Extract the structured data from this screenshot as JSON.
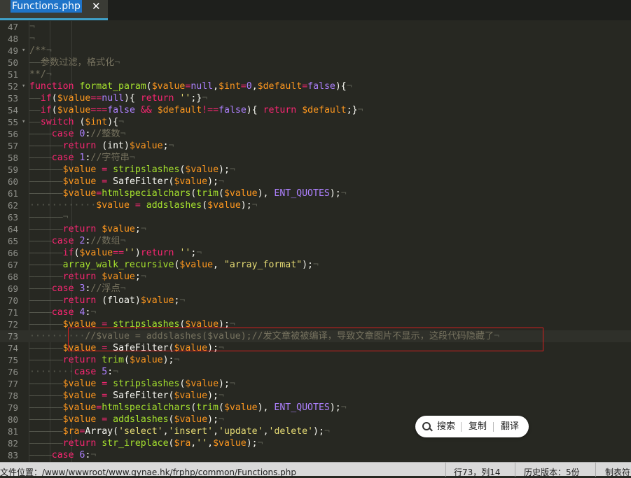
{
  "tab": {
    "title": "Functions.php",
    "close": "✕"
  },
  "lines": [
    {
      "n": "47",
      "fold": "",
      "segs": [
        [
          "w",
          "¬"
        ]
      ]
    },
    {
      "n": "48",
      "fold": "",
      "segs": [
        [
          "w",
          "¬"
        ]
      ]
    },
    {
      "n": "49",
      "fold": "▾",
      "segs": [
        [
          "c",
          "/**"
        ],
        [
          "w",
          "¬"
        ]
      ]
    },
    {
      "n": "50",
      "fold": "",
      "segs": [
        [
          "w",
          "——"
        ],
        [
          "c",
          "参数过滤，格式化"
        ],
        [
          "w",
          "¬"
        ]
      ]
    },
    {
      "n": "51",
      "fold": "",
      "segs": [
        [
          "c",
          "**/"
        ],
        [
          "w",
          "¬"
        ]
      ]
    },
    {
      "n": "52",
      "fold": "▾",
      "segs": [
        [
          "k",
          "function"
        ],
        [
          "t",
          " "
        ],
        [
          "f",
          "format_param"
        ],
        [
          "t",
          "("
        ],
        [
          "v",
          "$value"
        ],
        [
          "k",
          "="
        ],
        [
          "n",
          "null"
        ],
        [
          "t",
          ","
        ],
        [
          "v",
          "$int"
        ],
        [
          "k",
          "="
        ],
        [
          "n",
          "0"
        ],
        [
          "t",
          ","
        ],
        [
          "v",
          "$default"
        ],
        [
          "k",
          "="
        ],
        [
          "n",
          "false"
        ],
        [
          "t",
          "){"
        ],
        [
          "w",
          "¬"
        ]
      ]
    },
    {
      "n": "53",
      "fold": "",
      "segs": [
        [
          "w",
          "——"
        ],
        [
          "k",
          "if"
        ],
        [
          "t",
          "("
        ],
        [
          "v",
          "$value"
        ],
        [
          "k",
          "=="
        ],
        [
          "n",
          "null"
        ],
        [
          "t",
          "){ "
        ],
        [
          "k",
          "return"
        ],
        [
          "t",
          " "
        ],
        [
          "s1",
          "''"
        ],
        [
          "t",
          ";}"
        ],
        [
          "w",
          "¬"
        ]
      ]
    },
    {
      "n": "54",
      "fold": "",
      "segs": [
        [
          "w",
          "——"
        ],
        [
          "k",
          "if"
        ],
        [
          "t",
          "("
        ],
        [
          "v",
          "$value"
        ],
        [
          "k",
          "==="
        ],
        [
          "n",
          "false"
        ],
        [
          "t",
          " "
        ],
        [
          "k",
          "&&"
        ],
        [
          "t",
          " "
        ],
        [
          "v",
          "$default"
        ],
        [
          "k",
          "!=="
        ],
        [
          "n",
          "false"
        ],
        [
          "t",
          "){ "
        ],
        [
          "k",
          "return"
        ],
        [
          "t",
          " "
        ],
        [
          "v",
          "$default"
        ],
        [
          "t",
          ";}"
        ],
        [
          "w",
          "¬"
        ]
      ]
    },
    {
      "n": "55",
      "fold": "▾",
      "segs": [
        [
          "w",
          "——"
        ],
        [
          "k",
          "switch"
        ],
        [
          "t",
          " ("
        ],
        [
          "v",
          "$int"
        ],
        [
          "t",
          "){"
        ],
        [
          "w",
          "¬"
        ]
      ]
    },
    {
      "n": "56",
      "fold": "",
      "segs": [
        [
          "w",
          "————"
        ],
        [
          "k",
          "case"
        ],
        [
          "t",
          " "
        ],
        [
          "n",
          "0"
        ],
        [
          "t",
          ":"
        ],
        [
          "c",
          "//整数"
        ],
        [
          "w",
          "¬"
        ]
      ]
    },
    {
      "n": "57",
      "fold": "",
      "segs": [
        [
          "w",
          "——————"
        ],
        [
          "k",
          "return"
        ],
        [
          "t",
          " (int)"
        ],
        [
          "v",
          "$value"
        ],
        [
          "t",
          ";"
        ],
        [
          "w",
          "¬"
        ]
      ]
    },
    {
      "n": "58",
      "fold": "",
      "segs": [
        [
          "w",
          "————"
        ],
        [
          "k",
          "case"
        ],
        [
          "t",
          " "
        ],
        [
          "n",
          "1"
        ],
        [
          "t",
          ":"
        ],
        [
          "c",
          "//字符串"
        ],
        [
          "w",
          "¬"
        ]
      ]
    },
    {
      "n": "59",
      "fold": "",
      "segs": [
        [
          "w",
          "——————"
        ],
        [
          "v",
          "$value"
        ],
        [
          "t",
          " "
        ],
        [
          "k",
          "="
        ],
        [
          "t",
          " "
        ],
        [
          "f",
          "stripslashes"
        ],
        [
          "t",
          "("
        ],
        [
          "v",
          "$value"
        ],
        [
          "t",
          ");"
        ],
        [
          "w",
          "¬"
        ]
      ]
    },
    {
      "n": "60",
      "fold": "",
      "segs": [
        [
          "w",
          "——————"
        ],
        [
          "v",
          "$value"
        ],
        [
          "t",
          " "
        ],
        [
          "k",
          "="
        ],
        [
          "t",
          " SafeFilter("
        ],
        [
          "v",
          "$value"
        ],
        [
          "t",
          ");"
        ],
        [
          "w",
          "¬"
        ]
      ]
    },
    {
      "n": "61",
      "fold": "",
      "segs": [
        [
          "w",
          "——————"
        ],
        [
          "v",
          "$value"
        ],
        [
          "k",
          "="
        ],
        [
          "f",
          "htmlspecialchars"
        ],
        [
          "t",
          "("
        ],
        [
          "f",
          "trim"
        ],
        [
          "t",
          "("
        ],
        [
          "v",
          "$value"
        ],
        [
          "t",
          "), "
        ],
        [
          "n",
          "ENT_QUOTES"
        ],
        [
          "t",
          ");"
        ],
        [
          "w",
          "¬"
        ]
      ]
    },
    {
      "n": "62",
      "fold": "",
      "segs": [
        [
          "w",
          "············"
        ],
        [
          "v",
          "$value"
        ],
        [
          "t",
          " "
        ],
        [
          "k",
          "="
        ],
        [
          "t",
          " "
        ],
        [
          "f",
          "addslashes"
        ],
        [
          "t",
          "("
        ],
        [
          "v",
          "$value"
        ],
        [
          "t",
          ");"
        ],
        [
          "w",
          "¬"
        ]
      ]
    },
    {
      "n": "63",
      "fold": "",
      "segs": [
        [
          "w",
          "——————¬"
        ]
      ]
    },
    {
      "n": "64",
      "fold": "",
      "segs": [
        [
          "w",
          "——————"
        ],
        [
          "k",
          "return"
        ],
        [
          "t",
          " "
        ],
        [
          "v",
          "$value"
        ],
        [
          "t",
          ";"
        ],
        [
          "w",
          "¬"
        ]
      ]
    },
    {
      "n": "65",
      "fold": "",
      "segs": [
        [
          "w",
          "————"
        ],
        [
          "k",
          "case"
        ],
        [
          "t",
          " "
        ],
        [
          "n",
          "2"
        ],
        [
          "t",
          ":"
        ],
        [
          "c",
          "//数组"
        ],
        [
          "w",
          "¬"
        ]
      ]
    },
    {
      "n": "66",
      "fold": "",
      "segs": [
        [
          "w",
          "——————"
        ],
        [
          "k",
          "if"
        ],
        [
          "t",
          "("
        ],
        [
          "v",
          "$value"
        ],
        [
          "k",
          "=="
        ],
        [
          "s1",
          "''"
        ],
        [
          "t",
          ")"
        ],
        [
          "k",
          "return"
        ],
        [
          "t",
          " "
        ],
        [
          "s1",
          "''"
        ],
        [
          "t",
          ";"
        ],
        [
          "w",
          "¬"
        ]
      ]
    },
    {
      "n": "67",
      "fold": "",
      "segs": [
        [
          "w",
          "——————"
        ],
        [
          "f",
          "array_walk_recursive"
        ],
        [
          "t",
          "("
        ],
        [
          "v",
          "$value"
        ],
        [
          "t",
          ", "
        ],
        [
          "s1",
          "\"array_format\""
        ],
        [
          "t",
          ");"
        ],
        [
          "w",
          "¬"
        ]
      ]
    },
    {
      "n": "68",
      "fold": "",
      "segs": [
        [
          "w",
          "——————"
        ],
        [
          "k",
          "return"
        ],
        [
          "t",
          " "
        ],
        [
          "v",
          "$value"
        ],
        [
          "t",
          ";"
        ],
        [
          "w",
          "¬"
        ]
      ]
    },
    {
      "n": "69",
      "fold": "",
      "segs": [
        [
          "w",
          "————"
        ],
        [
          "k",
          "case"
        ],
        [
          "t",
          " "
        ],
        [
          "n",
          "3"
        ],
        [
          "t",
          ":"
        ],
        [
          "c",
          "//浮点"
        ],
        [
          "w",
          "¬"
        ]
      ]
    },
    {
      "n": "70",
      "fold": "",
      "segs": [
        [
          "w",
          "——————"
        ],
        [
          "k",
          "return"
        ],
        [
          "t",
          " (float)"
        ],
        [
          "v",
          "$value"
        ],
        [
          "t",
          ";"
        ],
        [
          "w",
          "¬"
        ]
      ]
    },
    {
      "n": "71",
      "fold": "",
      "segs": [
        [
          "w",
          "————"
        ],
        [
          "k",
          "case"
        ],
        [
          "t",
          " "
        ],
        [
          "n",
          "4"
        ],
        [
          "t",
          ":"
        ],
        [
          "w",
          "¬"
        ]
      ]
    },
    {
      "n": "72",
      "fold": "",
      "segs": [
        [
          "w",
          "——————"
        ],
        [
          "v",
          "$value"
        ],
        [
          "t",
          " "
        ],
        [
          "k",
          "="
        ],
        [
          "t",
          " "
        ],
        [
          "f",
          "stripslashes"
        ],
        [
          "t",
          "("
        ],
        [
          "v",
          "$value"
        ],
        [
          "t",
          ");"
        ],
        [
          "w",
          "¬"
        ]
      ]
    },
    {
      "n": "73",
      "fold": "",
      "segs": [
        [
          "w",
          "··········"
        ],
        [
          "c",
          "//$value = addslashes($value);//发文章被被编译，导致文章图片不显示，这段代码隐藏了"
        ],
        [
          "w",
          "¬"
        ]
      ]
    },
    {
      "n": "74",
      "fold": "",
      "segs": [
        [
          "w",
          "——————"
        ],
        [
          "v",
          "$value"
        ],
        [
          "t",
          " "
        ],
        [
          "k",
          "="
        ],
        [
          "t",
          " SafeFilter("
        ],
        [
          "v",
          "$value"
        ],
        [
          "t",
          ");"
        ],
        [
          "w",
          "¬"
        ]
      ]
    },
    {
      "n": "75",
      "fold": "",
      "segs": [
        [
          "w",
          "——————"
        ],
        [
          "k",
          "return"
        ],
        [
          "t",
          " "
        ],
        [
          "f",
          "trim"
        ],
        [
          "t",
          "("
        ],
        [
          "v",
          "$value"
        ],
        [
          "t",
          ");"
        ],
        [
          "w",
          "¬"
        ]
      ]
    },
    {
      "n": "76",
      "fold": "",
      "segs": [
        [
          "w",
          "········"
        ],
        [
          "k",
          "case"
        ],
        [
          "t",
          " "
        ],
        [
          "n",
          "5"
        ],
        [
          "t",
          ":"
        ],
        [
          "w",
          "¬"
        ]
      ]
    },
    {
      "n": "77",
      "fold": "",
      "segs": [
        [
          "w",
          "——————"
        ],
        [
          "v",
          "$value"
        ],
        [
          "t",
          " "
        ],
        [
          "k",
          "="
        ],
        [
          "t",
          " "
        ],
        [
          "f",
          "stripslashes"
        ],
        [
          "t",
          "("
        ],
        [
          "v",
          "$value"
        ],
        [
          "t",
          ");"
        ],
        [
          "w",
          "¬"
        ]
      ]
    },
    {
      "n": "78",
      "fold": "",
      "segs": [
        [
          "w",
          "——————"
        ],
        [
          "v",
          "$value"
        ],
        [
          "t",
          " "
        ],
        [
          "k",
          "="
        ],
        [
          "t",
          " SafeFilter("
        ],
        [
          "v",
          "$value"
        ],
        [
          "t",
          ");"
        ],
        [
          "w",
          "¬"
        ]
      ]
    },
    {
      "n": "79",
      "fold": "",
      "segs": [
        [
          "w",
          "——————"
        ],
        [
          "v",
          "$value"
        ],
        [
          "k",
          "="
        ],
        [
          "f",
          "htmlspecialchars"
        ],
        [
          "t",
          "("
        ],
        [
          "f",
          "trim"
        ],
        [
          "t",
          "("
        ],
        [
          "v",
          "$value"
        ],
        [
          "t",
          "), "
        ],
        [
          "n",
          "ENT_QUOTES"
        ],
        [
          "t",
          ");"
        ],
        [
          "w",
          "¬"
        ]
      ]
    },
    {
      "n": "80",
      "fold": "",
      "segs": [
        [
          "w",
          "——————"
        ],
        [
          "v",
          "$value"
        ],
        [
          "t",
          " "
        ],
        [
          "k",
          "="
        ],
        [
          "t",
          " "
        ],
        [
          "f",
          "addslashes"
        ],
        [
          "t",
          "("
        ],
        [
          "v",
          "$value"
        ],
        [
          "t",
          ");"
        ],
        [
          "w",
          "¬"
        ]
      ]
    },
    {
      "n": "81",
      "fold": "",
      "segs": [
        [
          "w",
          "——————"
        ],
        [
          "v",
          "$ra"
        ],
        [
          "k",
          "="
        ],
        [
          "t",
          "Array("
        ],
        [
          "s1",
          "'select'"
        ],
        [
          "t",
          ","
        ],
        [
          "s1",
          "'insert'"
        ],
        [
          "t",
          ","
        ],
        [
          "s1",
          "'update'"
        ],
        [
          "t",
          ","
        ],
        [
          "s1",
          "'delete'"
        ],
        [
          "t",
          ");"
        ],
        [
          "w",
          "¬"
        ]
      ]
    },
    {
      "n": "82",
      "fold": "",
      "segs": [
        [
          "w",
          "——————"
        ],
        [
          "k",
          "return"
        ],
        [
          "t",
          " "
        ],
        [
          "f",
          "str_ireplace"
        ],
        [
          "t",
          "("
        ],
        [
          "v",
          "$ra"
        ],
        [
          "t",
          ","
        ],
        [
          "s1",
          "''"
        ],
        [
          "t",
          ","
        ],
        [
          "v",
          "$value"
        ],
        [
          "t",
          ");"
        ],
        [
          "w",
          "¬"
        ]
      ]
    },
    {
      "n": "83",
      "fold": "",
      "segs": [
        [
          "w",
          "————"
        ],
        [
          "k",
          "case"
        ],
        [
          "t",
          " "
        ],
        [
          "n",
          "6"
        ],
        [
          "t",
          ":"
        ],
        [
          "w",
          "¬"
        ]
      ]
    }
  ],
  "popup": {
    "search": "搜索",
    "copy": "复制",
    "translate": "翻译"
  },
  "status": {
    "path": "文件位置：/www/wwwroot/www.gynae.hk/frphp/common/Functions.php",
    "position": "行73，列14",
    "history": "历史版本：5份",
    "tabs": "制表符"
  },
  "colors": {
    "background": "#272822",
    "keyword": "#f92672",
    "function": "#a6e22e",
    "variable": "#fd971f",
    "number": "#ae81ff",
    "string": "#e6db74",
    "comment": "#75715e",
    "highlight": "#d61f1f"
  }
}
